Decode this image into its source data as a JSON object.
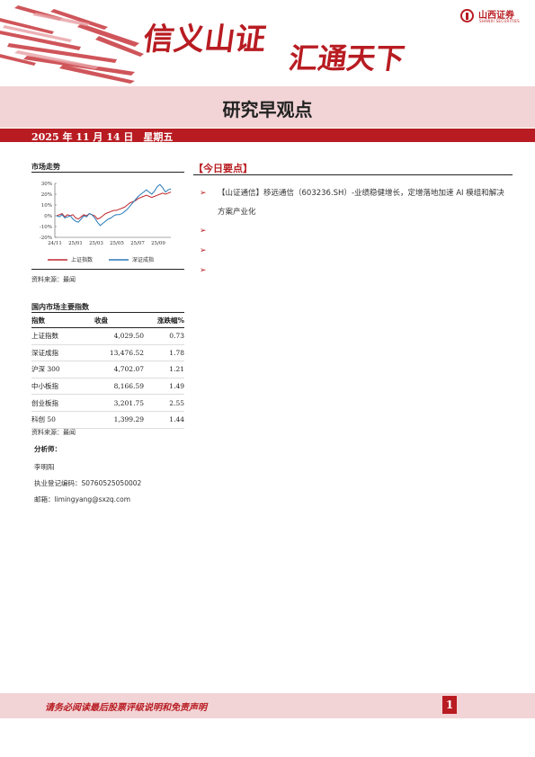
{
  "header": {
    "slogan_left": "信义山证",
    "slogan_right": "汇通天下",
    "brand_cn": "山西证券",
    "brand_en": "SHANXI SECURITIES",
    "accent_color": "#b81c22"
  },
  "title": "研究早观点",
  "date_line": "2025 年 11 月 14 日　星期五",
  "market_trend": {
    "label": "市场走势",
    "source": "资料来源：最闻",
    "chart_data": {
      "type": "line",
      "x_ticks": [
        "24/11",
        "25/01",
        "25/03",
        "25/05",
        "25/07",
        "25/09"
      ],
      "y_ticks": [
        "30%",
        "20%",
        "10%",
        "0%",
        "-10%",
        "-20%"
      ],
      "ylim": [
        -20,
        30
      ],
      "series": [
        {
          "name": "上证指数",
          "color": "#c0282e",
          "values": [
            0,
            1,
            2,
            -1,
            1,
            0,
            1,
            -2,
            -3,
            -1,
            1,
            0,
            2,
            1,
            0,
            -3,
            -2,
            0,
            2,
            3,
            4,
            5,
            5,
            6,
            7,
            8,
            10,
            12,
            13,
            14,
            16,
            17,
            18,
            19,
            18,
            17,
            18,
            19,
            20,
            21,
            20,
            21,
            22
          ]
        },
        {
          "name": "深证成指",
          "color": "#2a7ab8",
          "values": [
            0,
            -1,
            1,
            -2,
            -1,
            0,
            -3,
            -5,
            -6,
            -3,
            0,
            -1,
            2,
            1,
            -2,
            -6,
            -9,
            -7,
            -5,
            -3,
            -2,
            0,
            1,
            1,
            2,
            4,
            6,
            9,
            12,
            15,
            18,
            20,
            22,
            24,
            22,
            20,
            23,
            27,
            29,
            26,
            22,
            24,
            25
          ]
        }
      ]
    }
  },
  "indices": {
    "label": "国内市场主要指数",
    "columns": [
      "指数",
      "收盘",
      "涨跌幅%"
    ],
    "rows": [
      {
        "name": "上证指数",
        "close": "4,029.50",
        "change": "0.73"
      },
      {
        "name": "深证成指",
        "close": "13,476.52",
        "change": "1.78"
      },
      {
        "name": "沪深 300",
        "close": "4,702.07",
        "change": "1.21"
      },
      {
        "name": "中小板指",
        "close": "8,166.59",
        "change": "1.49"
      },
      {
        "name": "创业板指",
        "close": "3,201.75",
        "change": "2.55"
      },
      {
        "name": "科创 50",
        "close": "1,399.29",
        "change": "1.44"
      }
    ],
    "source": "资料来源：最闻"
  },
  "analyst": {
    "label": "分析师：",
    "name": "李明阳",
    "license": "执业登记编码：S0760525050002",
    "email": "邮箱：limingyang@sxzq.com"
  },
  "today": {
    "heading": "【今日要点】",
    "bullet_glyph": "➢",
    "items": [
      "【山证通信】移远通信（603236.SH）-业绩稳健增长，定增落地加速 AI 模组和解决方案产业化",
      "",
      "",
      ""
    ]
  },
  "footer": {
    "disclaimer": "请务必阅读最后股票评级说明和免责声明",
    "page_number": "1"
  }
}
